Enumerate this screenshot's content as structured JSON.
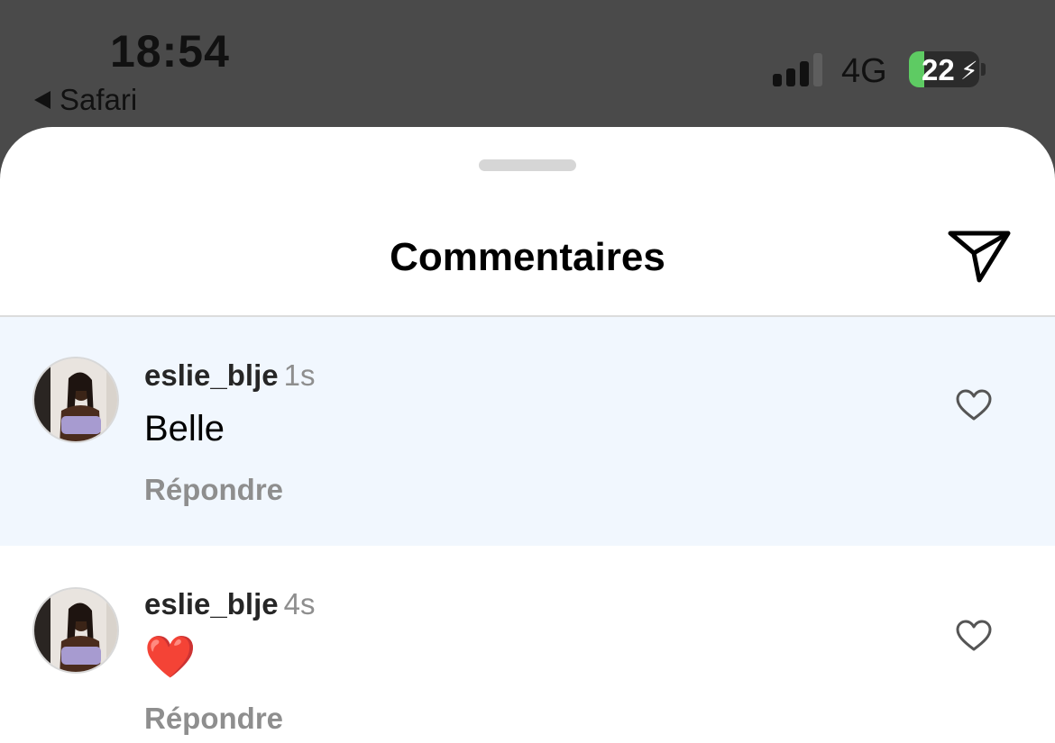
{
  "status_bar": {
    "time": "18:54",
    "back_app": "Safari",
    "network": "4G",
    "battery": "22"
  },
  "sheet": {
    "title": "Commentaires",
    "share_icon": "paper-plane-icon"
  },
  "comments": [
    {
      "username": "eslie_blje",
      "time": "1s",
      "text": "Belle",
      "reply_label": "Répondre",
      "highlighted": true,
      "like_icon": "heart-outline-icon"
    },
    {
      "username": "eslie_blje",
      "time": "4s",
      "text": "❤️",
      "reply_label": "Répondre",
      "highlighted": false,
      "like_icon": "heart-outline-icon"
    }
  ],
  "colors": {
    "status_bar_bg": "#4a4a4a",
    "highlight_bg": "#f1f7fe",
    "muted_text": "#8e8e8e",
    "battery_green": "#5ecb63",
    "heart_red": "#e0242d"
  }
}
